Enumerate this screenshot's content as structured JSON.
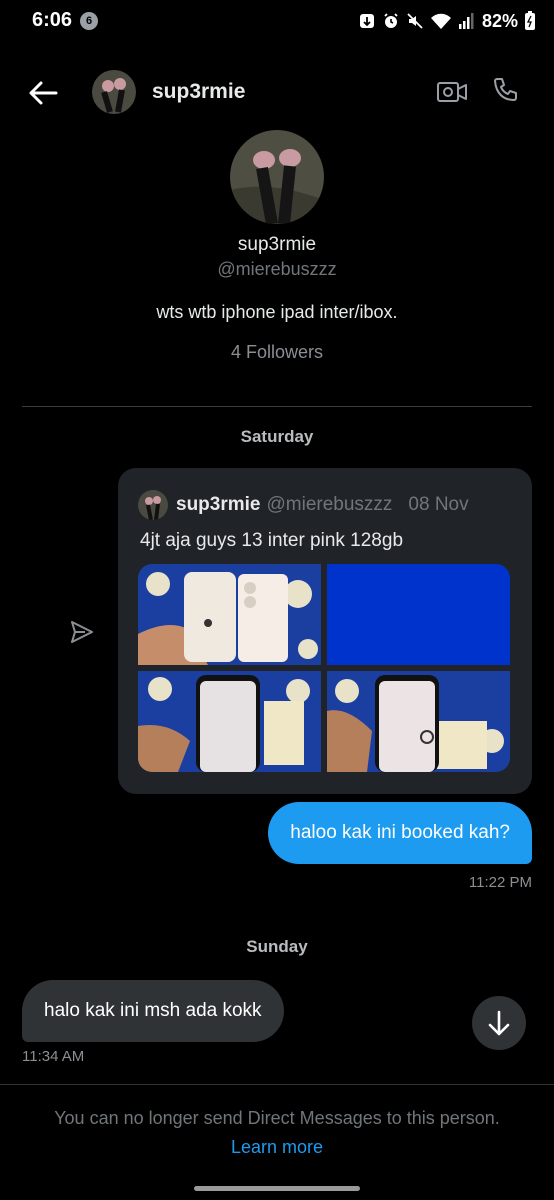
{
  "status_bar": {
    "time": "6:06",
    "notification_count": "6",
    "battery": "82%"
  },
  "header": {
    "username": "sup3rmie"
  },
  "profile": {
    "name": "sup3rmie",
    "handle": "@mierebuszzz",
    "bio": "wts wtb iphone ipad inter/ibox.",
    "followers": "4 Followers"
  },
  "conversation": {
    "day1": "Saturday",
    "shared_tweet": {
      "name": "sup3rmie",
      "handle": "@mierebuszzz",
      "date": "08 Nov",
      "text": "4jt aja guys 13 inter pink 128gb"
    },
    "sent_message": {
      "text": "haloo kak ini booked kah?",
      "time": "11:22 PM"
    },
    "day2": "Sunday",
    "received_message": {
      "text": "halo kak ini msh ada kokk",
      "time": "11:34 AM"
    }
  },
  "footer": {
    "notice": "You can no longer send Direct Messages to this person.",
    "link": "Learn more"
  },
  "colors": {
    "accent": "#1d9bf0",
    "background": "#000000",
    "bubble_in": "#2f3336",
    "card": "#202327"
  }
}
